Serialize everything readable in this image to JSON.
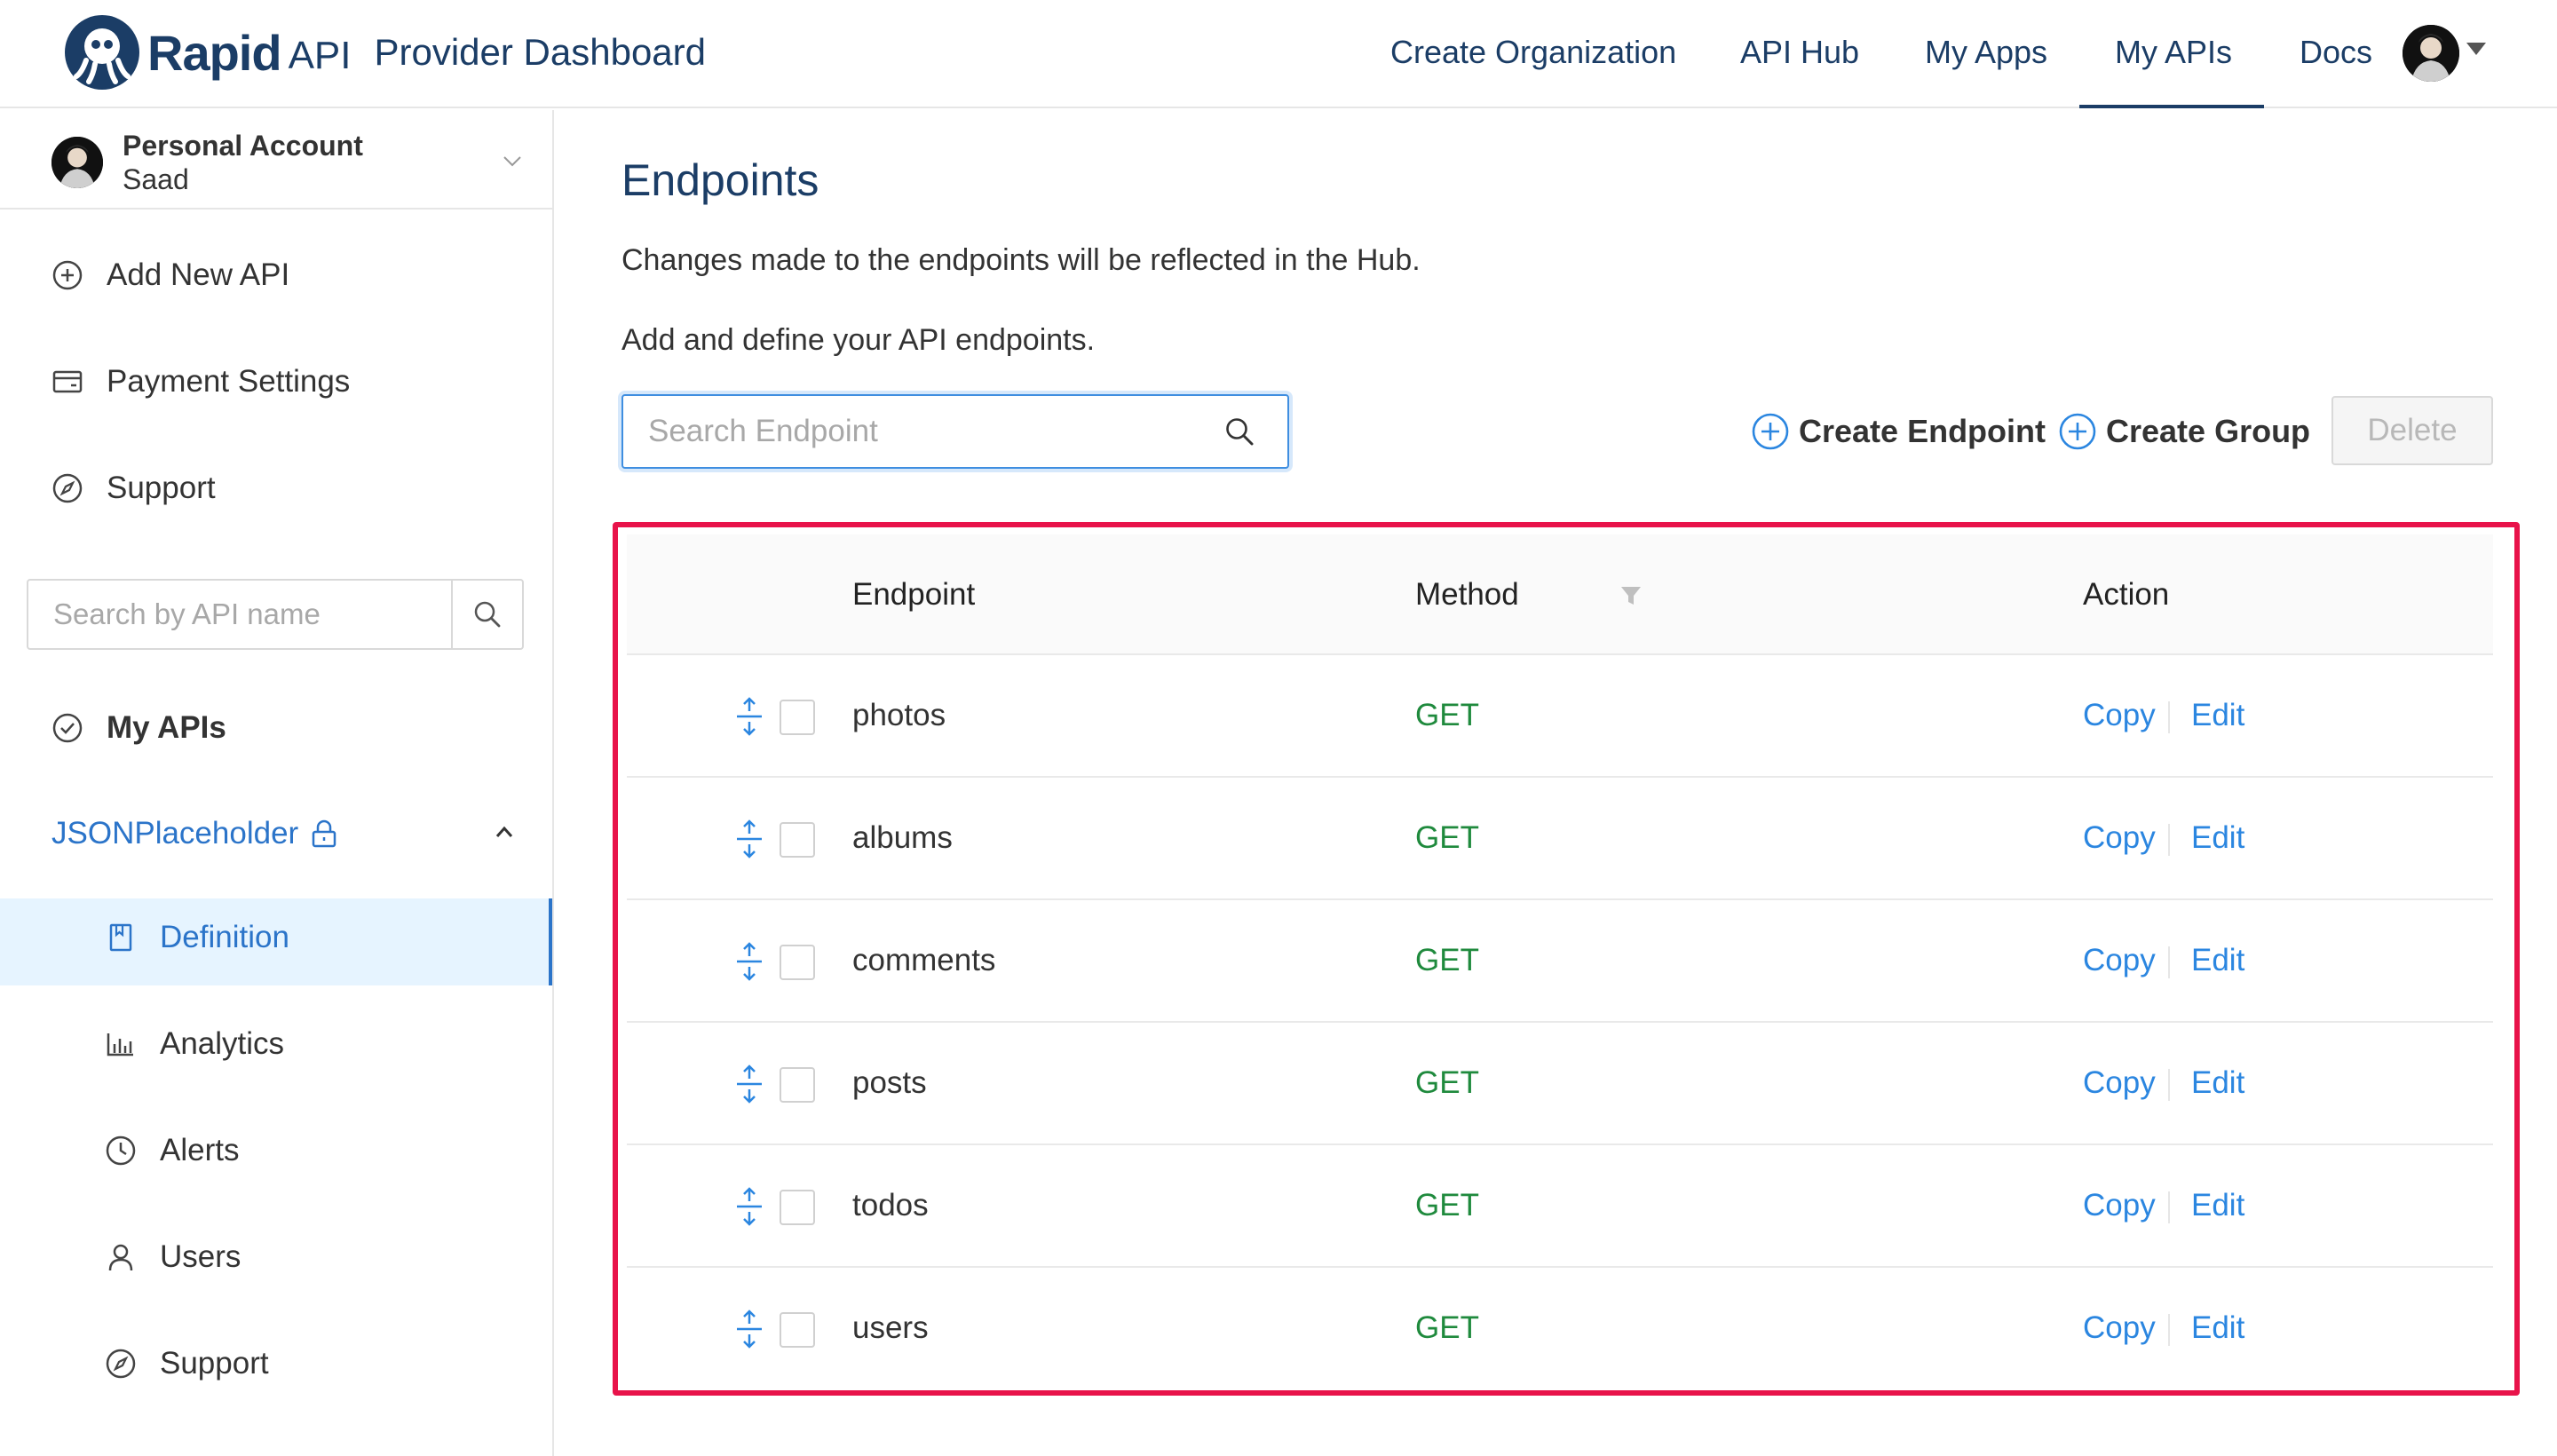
{
  "header": {
    "brand_rapid": "Rapid",
    "brand_api": "API",
    "brand_title": "Provider Dashboard",
    "nav": [
      {
        "label": "Create Organization"
      },
      {
        "label": "API Hub"
      },
      {
        "label": "My Apps"
      },
      {
        "label": "My APIs",
        "active": true
      },
      {
        "label": "Docs"
      }
    ]
  },
  "sidebar": {
    "account_type": "Personal Account",
    "account_name": "Saad",
    "menu": [
      {
        "label": "Add New API",
        "icon": "plus-circle-icon"
      },
      {
        "label": "Payment Settings",
        "icon": "card-icon"
      },
      {
        "label": "Support",
        "icon": "compass-icon"
      }
    ],
    "search_placeholder": "Search by API name",
    "my_apis_label": "My APIs",
    "api_name": "JSONPlaceholder",
    "api_items": [
      {
        "label": "Definition",
        "icon": "book-icon",
        "active": true
      },
      {
        "label": "Analytics",
        "icon": "bar-chart-icon"
      },
      {
        "label": "Alerts",
        "icon": "clock-icon"
      },
      {
        "label": "Users",
        "icon": "user-icon"
      },
      {
        "label": "Support",
        "icon": "compass-icon"
      }
    ]
  },
  "main": {
    "title": "Endpoints",
    "desc1": "Changes made to the endpoints will be reflected in the Hub.",
    "desc2": "Add and define your API endpoints.",
    "search_placeholder": "Search Endpoint",
    "create_endpoint": "Create Endpoint",
    "create_group": "Create Group",
    "delete": "Delete",
    "accent_color": "#2b86e0",
    "method_color": "#1f8a3d",
    "highlight_color": "#e8134a",
    "table": {
      "columns": {
        "endpoint": "Endpoint",
        "method": "Method",
        "action": "Action"
      },
      "copy_label": "Copy",
      "edit_label": "Edit",
      "rows": [
        {
          "name": "photos",
          "method": "GET"
        },
        {
          "name": "albums",
          "method": "GET"
        },
        {
          "name": "comments",
          "method": "GET"
        },
        {
          "name": "posts",
          "method": "GET"
        },
        {
          "name": "todos",
          "method": "GET"
        },
        {
          "name": "users",
          "method": "GET"
        }
      ]
    }
  }
}
